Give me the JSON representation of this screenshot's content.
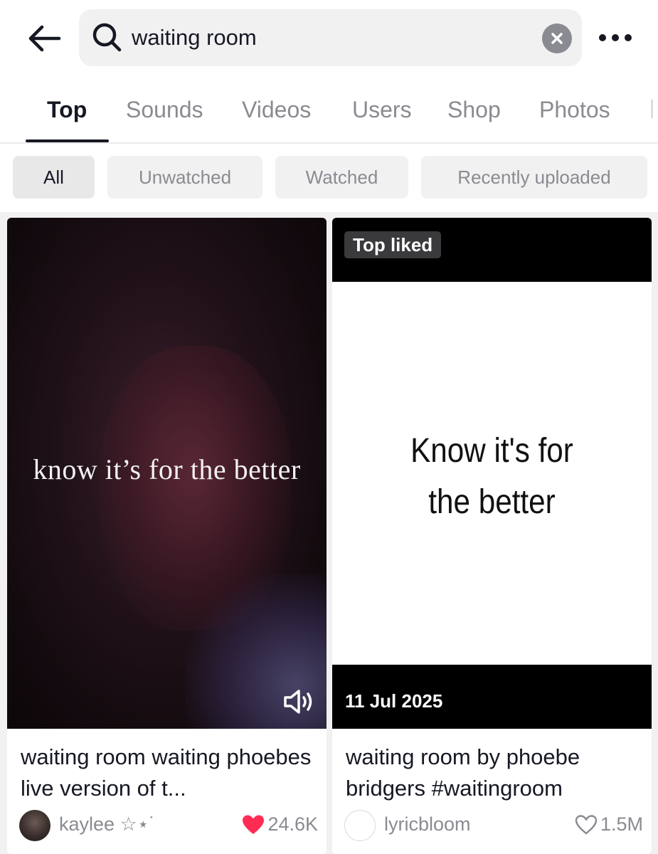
{
  "header": {
    "back_icon": "arrow-left-icon",
    "search": {
      "value": "waiting room",
      "icon": "search-icon"
    },
    "clear_icon": "close-icon",
    "more_icon": "ellipsis-icon"
  },
  "tabs": [
    {
      "label": "Top",
      "active": true
    },
    {
      "label": "Sounds",
      "active": false
    },
    {
      "label": "Videos",
      "active": false
    },
    {
      "label": "Users",
      "active": false
    },
    {
      "label": "Shop",
      "active": false
    },
    {
      "label": "Photos",
      "active": false
    }
  ],
  "filters": [
    {
      "label": "All",
      "active": true
    },
    {
      "label": "Unwatched",
      "active": false
    },
    {
      "label": "Watched",
      "active": false
    },
    {
      "label": "Recently uploaded",
      "active": false
    }
  ],
  "results": [
    {
      "overlay_text": "know it’s for the better",
      "sound_icon": "speaker-icon",
      "title": "waiting room waiting phoebes live version of t...",
      "author": "kaylee ☆⋆˙",
      "likes": "24.6K",
      "liked": true,
      "like_color": "#fe2c55"
    },
    {
      "badge": "Top liked",
      "overlay_text_line1": "Know it's for",
      "overlay_text_line2": "the better",
      "date": "11 Jul 2025",
      "title": "waiting room by phoebe bridgers #waitingroom",
      "author": "lyricbloom",
      "likes": "1.5M",
      "liked": false
    }
  ]
}
